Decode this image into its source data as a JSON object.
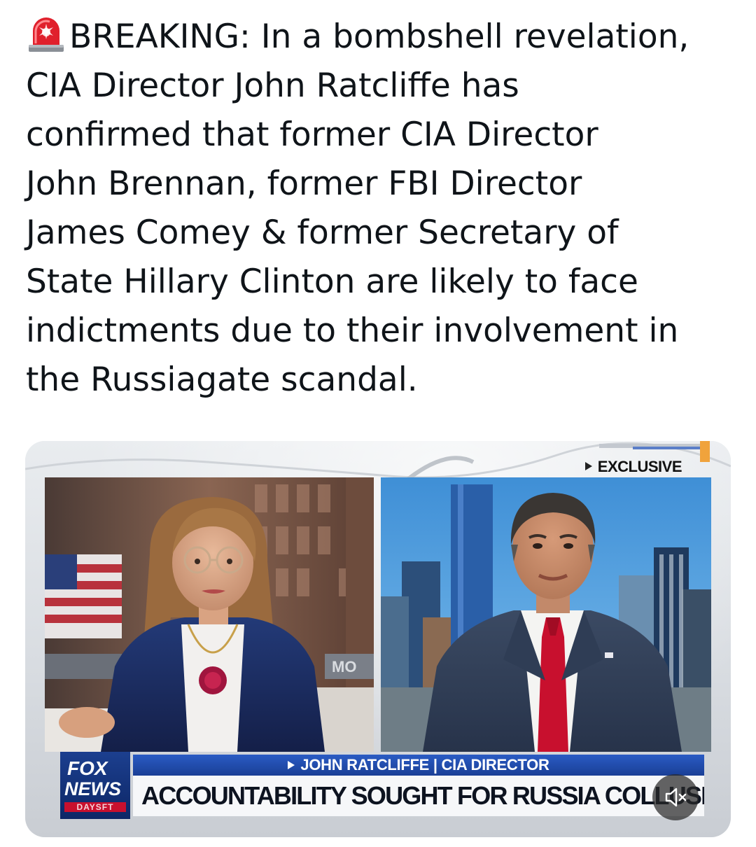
{
  "post": {
    "alert_emoji": "rotating-light-icon",
    "text_lines": [
      "BREAKING: In a bombshell revelation,",
      "CIA Director John Ratcliffe has",
      "confirmed that former CIA Director",
      "John Brennan, former FBI Director",
      "James Comey & former Secretary of",
      "State Hillary Clinton are likely to face",
      "indictments due to their involvement in",
      "the Russiagate scandal."
    ]
  },
  "video": {
    "exclusive_tag": "EXCLUSIVE",
    "network_logo_top": "FOX",
    "network_logo_bottom": "NEWS",
    "network_logo_sub": "DAYSFT",
    "name_bar": "JOHN RATCLIFFE | CIA DIRECTOR",
    "headline": "ACCOUNTABILITY SOUGHT FOR RUSSIA COLLUSION ORIGINS",
    "mute_icon": "speaker-muted-icon",
    "colors": {
      "fox_blue": "#1c3f8f",
      "name_bar_blue": "#2a5bc4",
      "tie_red": "#c8102e"
    }
  }
}
